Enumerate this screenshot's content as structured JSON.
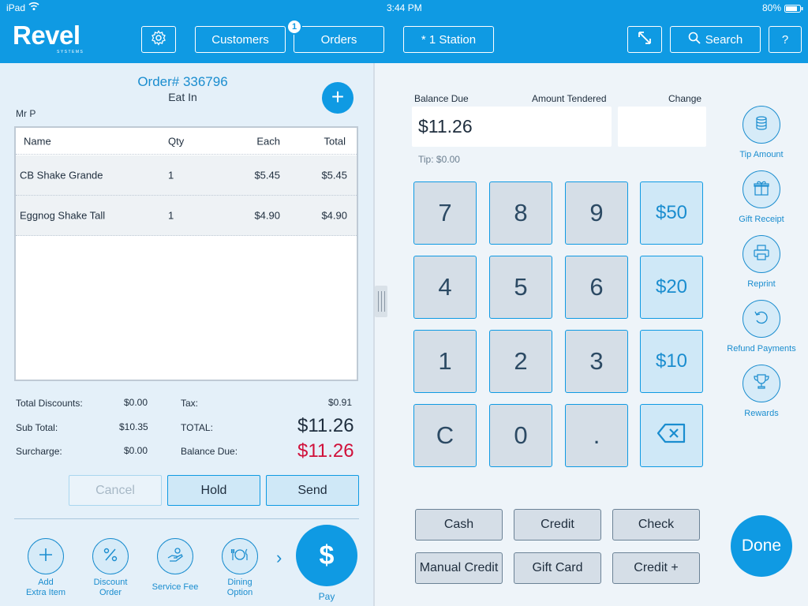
{
  "status_bar": {
    "device": "iPad",
    "time": "3:44 PM",
    "battery": "80%"
  },
  "header": {
    "logo": "Revel",
    "logo_sub": "SYSTEMS",
    "customers": "Customers",
    "orders": "Orders",
    "orders_badge": "1",
    "station": "* 1 Station",
    "search": "Search",
    "help": "?"
  },
  "order": {
    "number": "Order# 336796",
    "type": "Eat In",
    "customer": "Mr P",
    "columns": [
      "Name",
      "Qty",
      "Each",
      "Total"
    ],
    "items": [
      {
        "name": "CB Shake Grande",
        "qty": "1",
        "each": "$5.45",
        "total": "$5.45"
      },
      {
        "name": "Eggnog Shake Tall",
        "qty": "1",
        "each": "$4.90",
        "total": "$4.90"
      }
    ]
  },
  "summary": {
    "total_discounts_label": "Total Discounts:",
    "total_discounts": "$0.00",
    "sub_total_label": "Sub Total:",
    "sub_total": "$10.35",
    "surcharge_label": "Surcharge:",
    "surcharge": "$0.00",
    "tax_label": "Tax:",
    "tax": "$0.91",
    "total_label": "TOTAL:",
    "total": "$11.26",
    "balance_due_label": "Balance Due:",
    "balance_due": "$11.26"
  },
  "actions": {
    "cancel": "Cancel",
    "hold": "Hold",
    "send": "Send"
  },
  "tools": {
    "add_extra_line1": "Add",
    "add_extra_line2": "Extra Item",
    "discount_line1": "Discount",
    "discount_line2": "Order",
    "service_fee": "Service Fee",
    "dining_line1": "Dining",
    "dining_line2": "Option",
    "pay": "Pay"
  },
  "payment": {
    "balance_due_label": "Balance Due",
    "amount_tendered_label": "Amount Tendered",
    "change_label": "Change",
    "balance_value": "$11.26",
    "tip": "Tip: $0.00",
    "keys": {
      "k7": "7",
      "k8": "8",
      "k9": "9",
      "k4": "4",
      "k5": "5",
      "k6": "6",
      "k1": "1",
      "k2": "2",
      "k3": "3",
      "kc": "C",
      "k0": "0",
      "kdot": ".",
      "m50": "$50",
      "m20": "$20",
      "m10": "$10"
    },
    "methods": {
      "cash": "Cash",
      "credit": "Credit",
      "check": "Check",
      "manual_credit": "Manual Credit",
      "gift_card": "Gift Card",
      "credit_plus": "Credit +"
    }
  },
  "side_actions": {
    "tip_amount": "Tip Amount",
    "gift_receipt": "Gift Receipt",
    "reprint": "Reprint",
    "refund_payments": "Refund Payments",
    "rewards": "Rewards",
    "done": "Done"
  }
}
